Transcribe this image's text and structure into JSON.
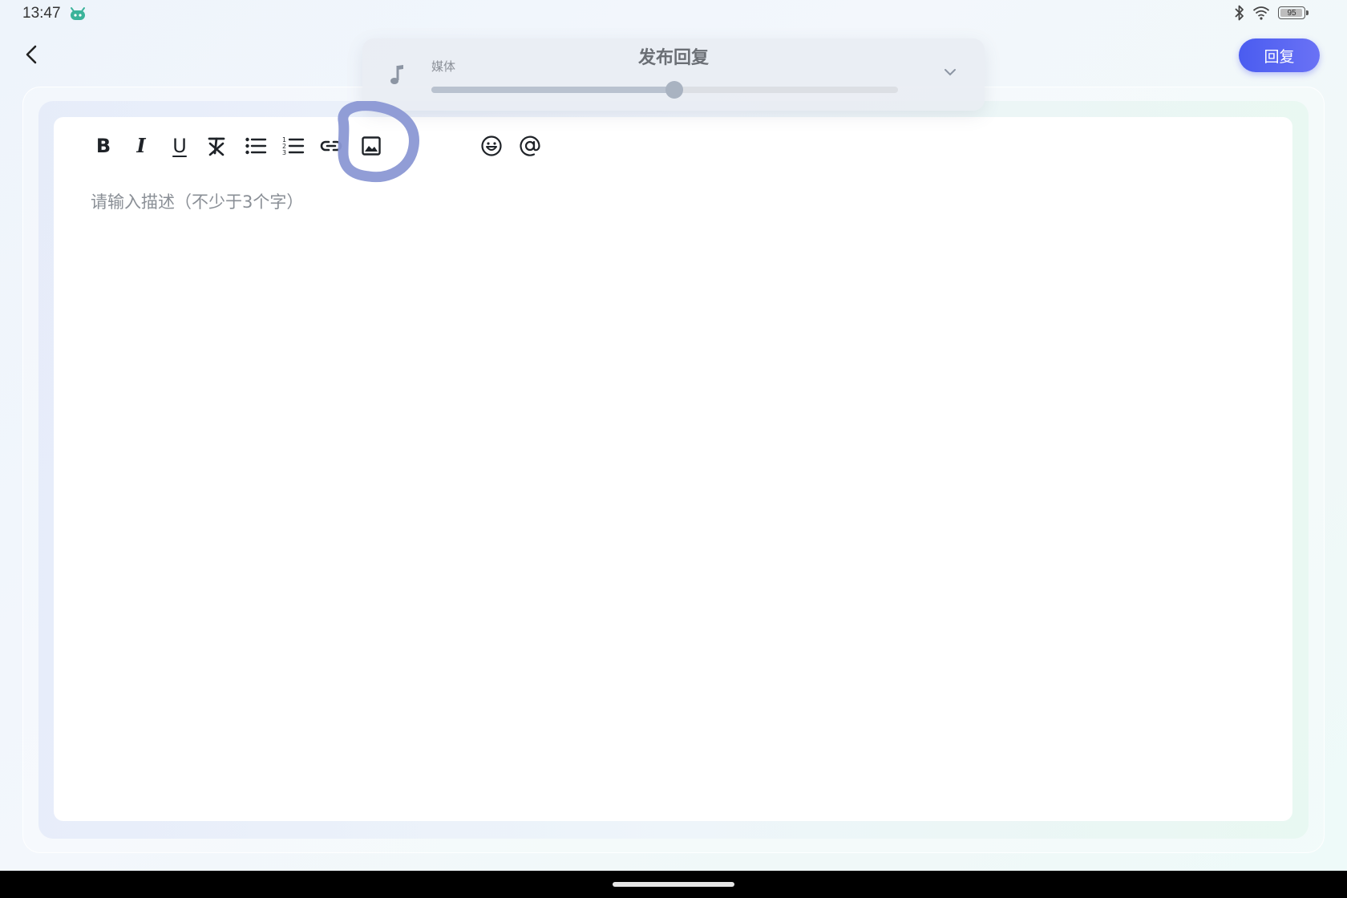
{
  "status_bar": {
    "time": "13:47",
    "app_icon": "android-mascot-icon",
    "bluetooth_icon": "bluetooth-icon",
    "wifi_icon": "wifi-icon",
    "battery_level": "95"
  },
  "header": {
    "back_icon": "chevron-left-icon",
    "title": "发布回复",
    "reply_label": "回复"
  },
  "volume_panel": {
    "icon": "music-note-icon",
    "label": "媒体",
    "level": 0.52,
    "expand_icon": "chevron-down-icon"
  },
  "toolbar": {
    "items": [
      {
        "name": "bold-button",
        "icon": "bold-icon",
        "glyph": "B"
      },
      {
        "name": "italic-button",
        "icon": "italic-icon",
        "glyph": "I"
      },
      {
        "name": "underline-button",
        "icon": "underline-icon",
        "glyph": "U"
      },
      {
        "name": "clear-format-button",
        "icon": "clear-format-icon"
      },
      {
        "name": "bullet-list-button",
        "icon": "bullet-list-icon"
      },
      {
        "name": "numbered-list-button",
        "icon": "numbered-list-icon"
      },
      {
        "name": "link-button",
        "icon": "link-icon"
      },
      {
        "name": "image-button",
        "icon": "image-icon"
      },
      {
        "name": "emoji-button",
        "icon": "emoji-icon"
      },
      {
        "name": "mention-button",
        "icon": "at-sign-icon"
      }
    ]
  },
  "editor": {
    "placeholder": "请输入描述（不少于3个字）"
  },
  "annotation": {
    "color": "#8b98d4",
    "target": "image-button"
  },
  "colors": {
    "accent": "#4a5cf0"
  }
}
